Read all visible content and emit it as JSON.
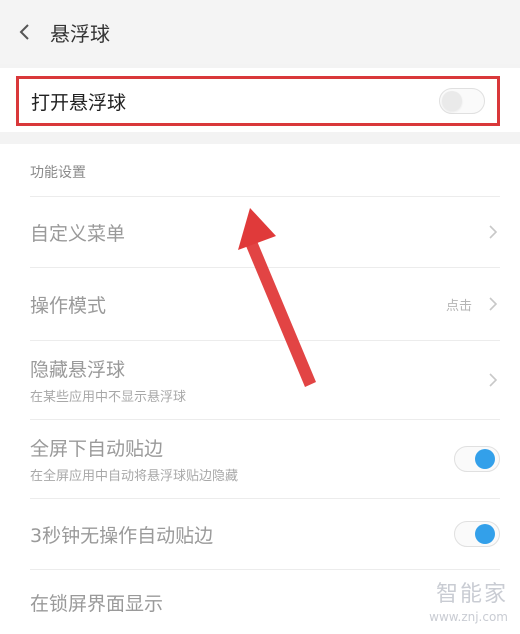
{
  "header": {
    "title": "悬浮球"
  },
  "main_toggle": {
    "label": "打开悬浮球",
    "state": "off"
  },
  "section": {
    "label": "功能设置"
  },
  "rows": [
    {
      "title": "自定义菜单",
      "subtitle": "",
      "value": "",
      "control": "chevron"
    },
    {
      "title": "操作模式",
      "subtitle": "",
      "value": "点击",
      "control": "chevron"
    },
    {
      "title": "隐藏悬浮球",
      "subtitle": "在某些应用中不显示悬浮球",
      "value": "",
      "control": "chevron"
    },
    {
      "title": "全屏下自动贴边",
      "subtitle": "在全屏应用中自动将悬浮球贴边隐藏",
      "value": "",
      "control": "toggle-on"
    },
    {
      "title": "3秒钟无操作自动贴边",
      "subtitle": "",
      "value": "",
      "control": "toggle-on"
    },
    {
      "title": "在锁屏界面显示",
      "subtitle": "",
      "value": "",
      "control": "none"
    }
  ],
  "watermark": {
    "name": "智能家",
    "url": "www.znj.com"
  },
  "colors": {
    "highlight": "#d9383a",
    "arrow": "#e03a3a",
    "toggle_on": "#33a0ea"
  }
}
